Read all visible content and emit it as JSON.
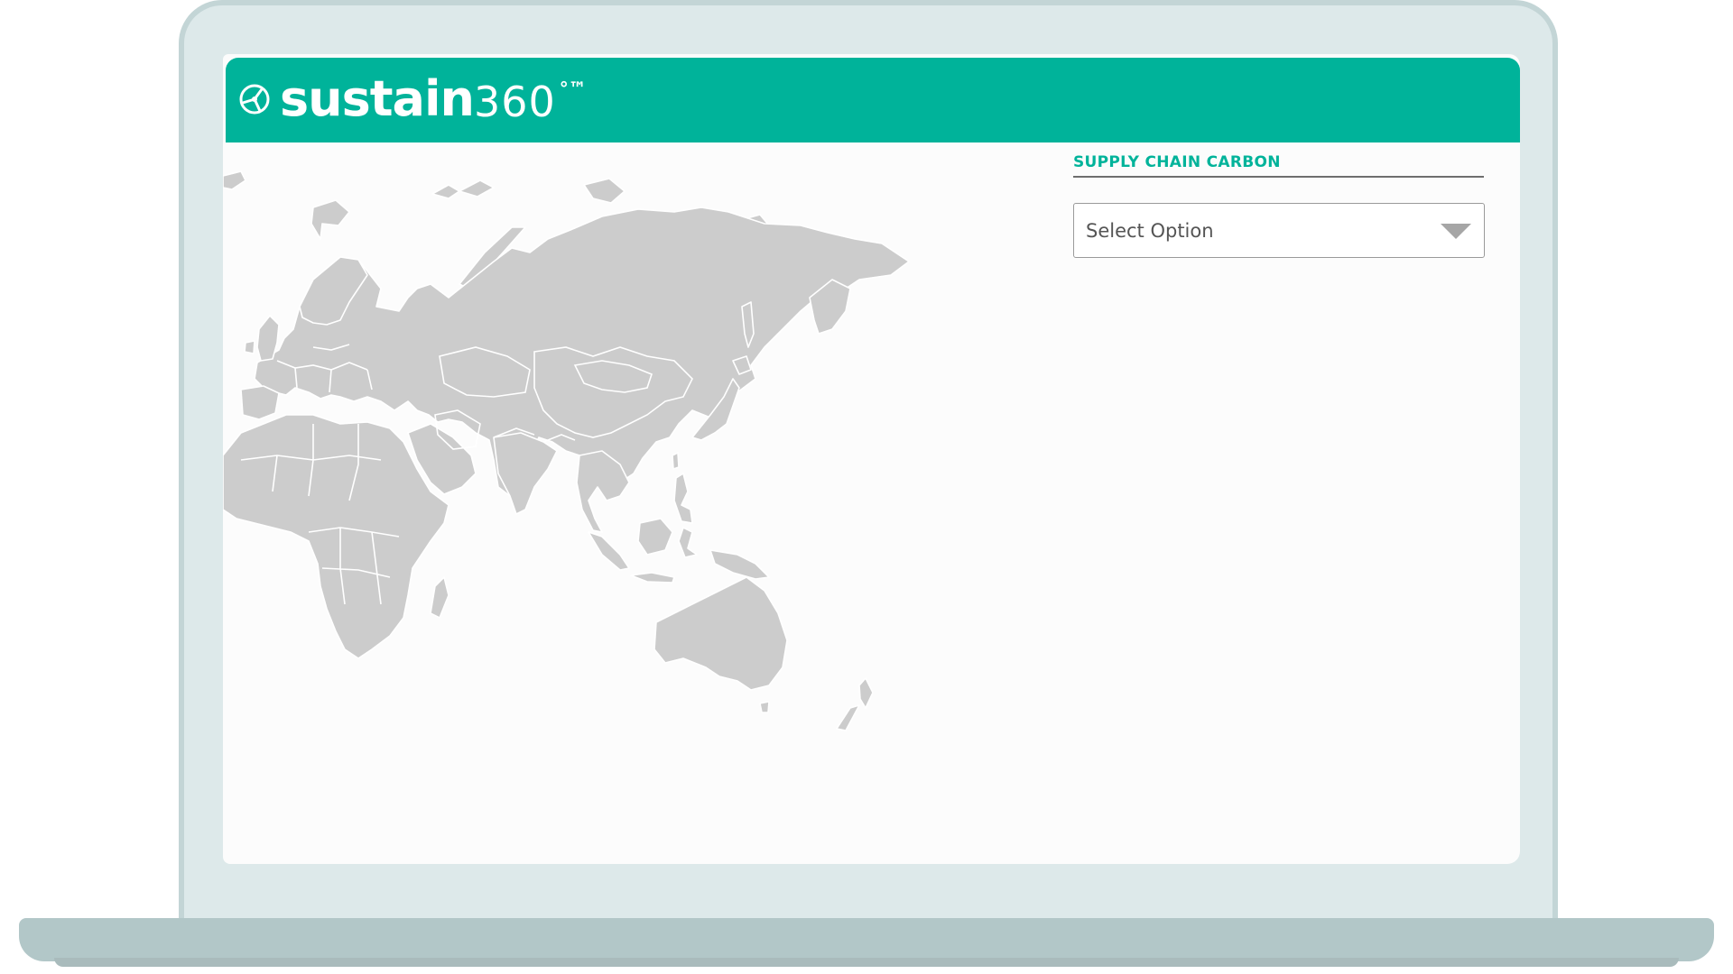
{
  "app": {
    "brand_word": "sustain",
    "brand_number": "360",
    "brand_mark": "°™",
    "logo_icon": "globe-propeller-icon"
  },
  "panel": {
    "title": "SUPPLY CHAIN CARBON",
    "select": {
      "value": "Select Option",
      "icon": "chevron-down-icon"
    }
  },
  "map": {
    "regions_shown": [
      "Europe",
      "Africa",
      "Asia",
      "Australia"
    ]
  },
  "colors": {
    "brand": "#00b39a",
    "land": "#cccccc",
    "device_frame": "#dde9ea",
    "device_base": "#b2c7c8"
  }
}
